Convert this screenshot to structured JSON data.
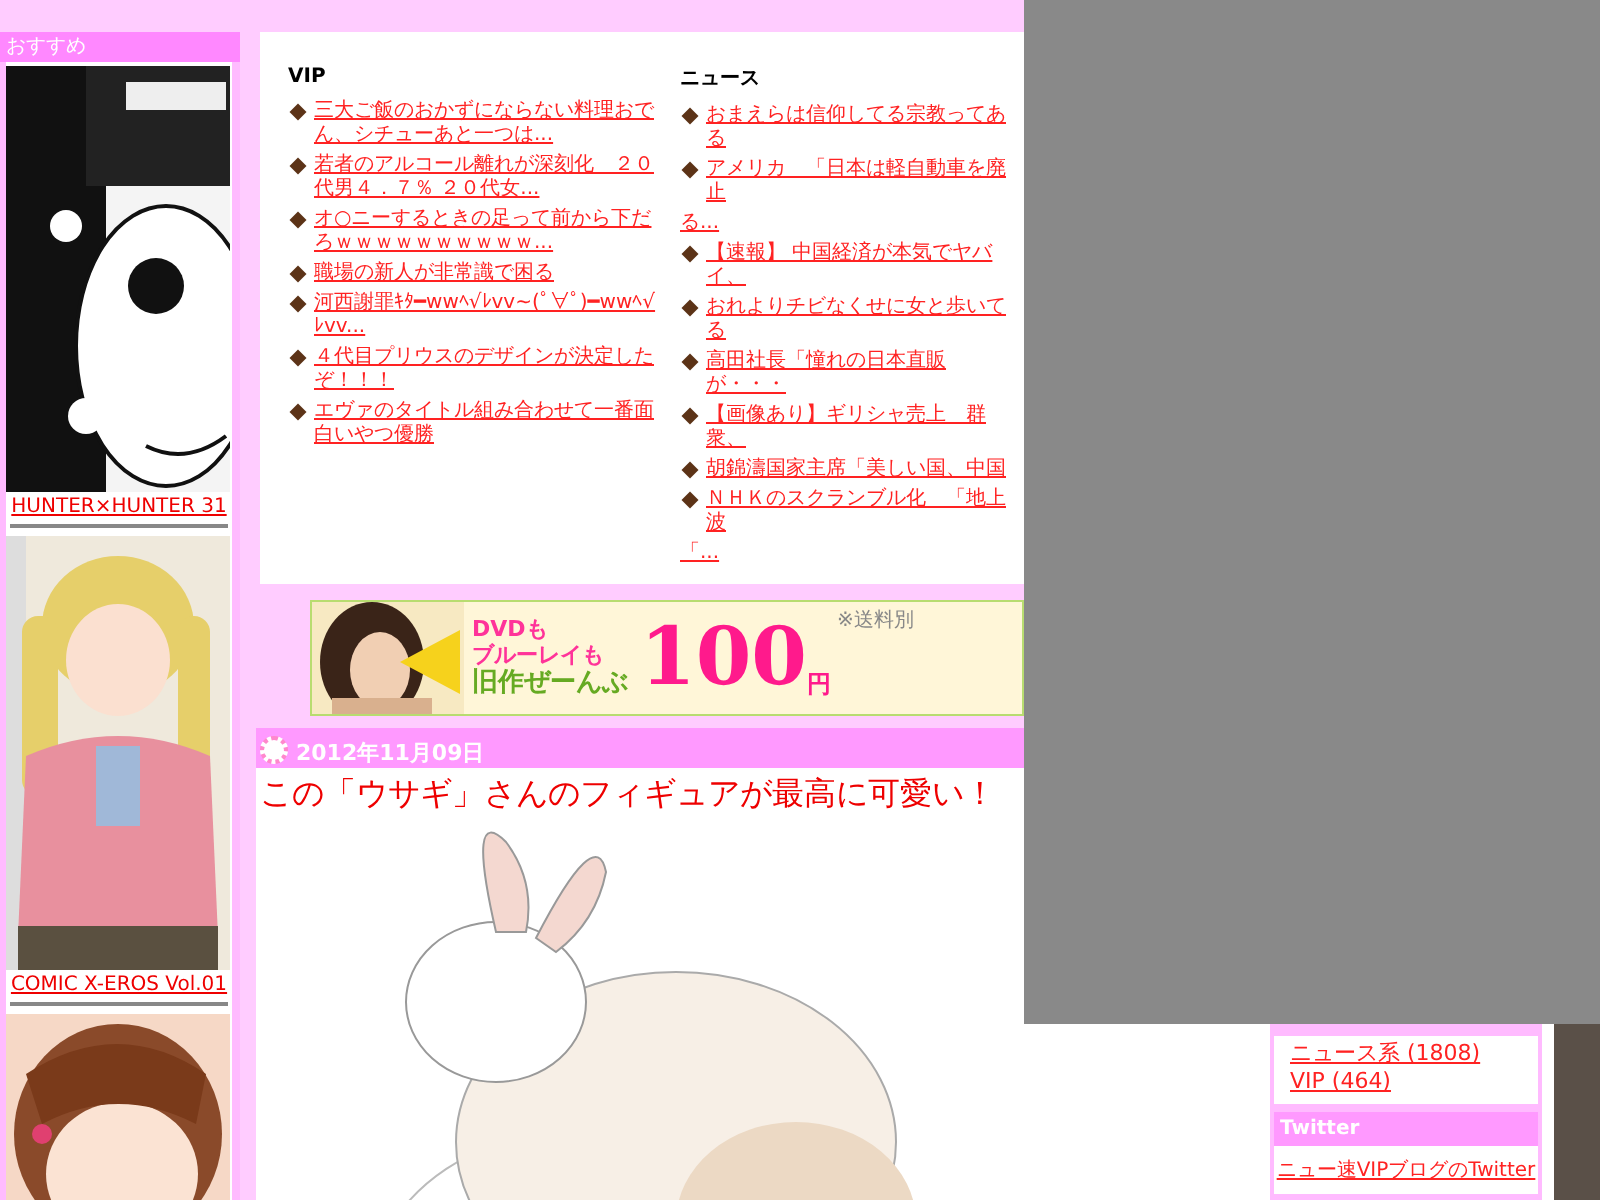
{
  "sidebar_left": {
    "title": "おすすめ",
    "items": [
      {
        "kind": "picture",
        "caption": "HUNTER×HUNTER 31"
      },
      {
        "kind": "picture",
        "caption": "COMIC X-EROS Vol.01"
      },
      {
        "kind": "picture"
      }
    ]
  },
  "headlines": [
    {
      "title": "VIP",
      "items": [
        {
          "text": "三大ご飯のおかずにならない料理おでん、シチューあと一つは..."
        },
        {
          "text": "若者のアルコール離れが深刻化　２０代男４．７％ ２０代女..."
        },
        {
          "text": "オ○ニーするときの足って前から下だろｗｗｗｗｗｗｗｗｗｗ..."
        },
        {
          "text": "職場の新人が非常識で困る"
        },
        {
          "text": "河西謝罪ｷﾀ━wwﾍ√ﾚvv~(ﾟ∀ﾟ)━wwﾍ√ﾚvv..."
        },
        {
          "text": "４代目プリウスのデザインが決定したぞ！！！"
        },
        {
          "text": "エヴァのタイトル組み合わせて一番面白いやつ優勝"
        }
      ]
    },
    {
      "title": "ニュース",
      "items": [
        {
          "text": "おまえらは信仰してる宗教ってある"
        },
        {
          "text": "アメリカ　「日本は軽自動車を廃止",
          "tail": "る..."
        },
        {
          "text": "【速報】 中国経済が本気でヤバイ、"
        },
        {
          "text": "おれよりチビなくせに女と歩いてる"
        },
        {
          "text": "高田社長「憧れの日本直販が・・・"
        },
        {
          "text": "【画像あり】ギリシャ売上　群衆、"
        },
        {
          "text": "胡錦濤国家主席「美しい国、中国"
        },
        {
          "text": "ＮＨＫのスクランブル化　「地上波",
          "tail": "「..."
        }
      ]
    }
  ],
  "banner": {
    "line_1": "DVDも",
    "line_2": "ブルーレイも",
    "line_3": "旧作ぜーんぶ",
    "price": "100",
    "unit": "円",
    "note": "※送料別"
  },
  "post": {
    "date": "2012年11月09日",
    "title": "この「ウサギ」さんのフィギュアが最高に可愛い！"
  },
  "sidebar_right": {
    "categories": [
      "ニュース系 (1808)",
      "VIP (464)"
    ],
    "twitter": {
      "title": "Twitter",
      "link": "ニュー速VIPブログのTwitter"
    }
  }
}
